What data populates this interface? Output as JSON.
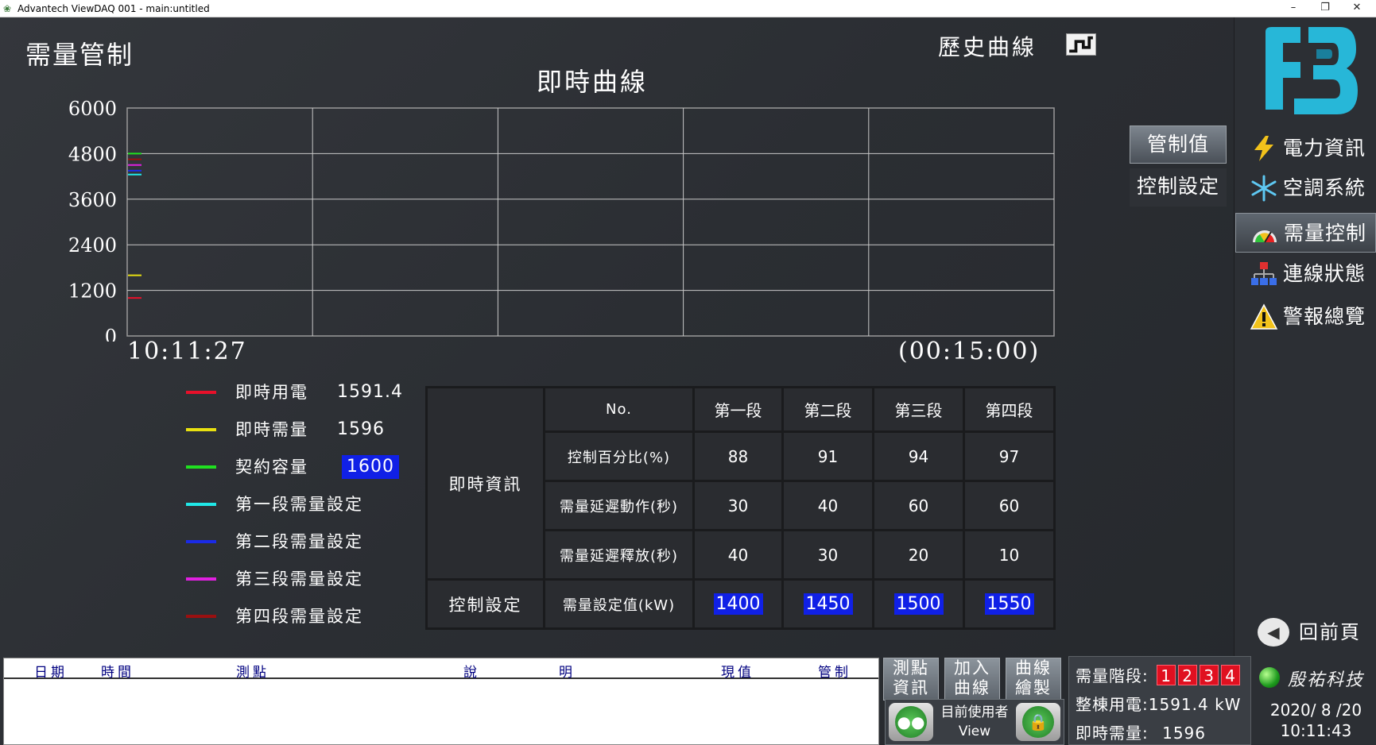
{
  "window": {
    "title": "Advantech ViewDAQ 001 - main:untitled",
    "minimize": "–",
    "restore": "❐",
    "close": "✕"
  },
  "header": {
    "page_title": "需量管制",
    "history_label": "歷史曲線"
  },
  "chart_data": {
    "type": "line",
    "title": "即時曲線",
    "ylim": [
      0,
      6000
    ],
    "y_ticks": [
      "6000",
      "4800",
      "3600",
      "2400",
      "1200",
      "0"
    ],
    "x_start_label": "10:11:27",
    "x_span_label": "(00:15:00)",
    "grid": true,
    "series": [
      {
        "name": "即時用電",
        "color": "#e8102a",
        "values": [
          1000
        ]
      },
      {
        "name": "即時需量",
        "color": "#e8e010",
        "values": [
          1596
        ]
      },
      {
        "name": "契約容量",
        "color": "#20e020",
        "values": [
          4800
        ]
      },
      {
        "name": "第一段需量設定",
        "color": "#20e8e8",
        "values": [
          4250
        ]
      },
      {
        "name": "第二段需量設定",
        "color": "#1a2ae8",
        "values": [
          4350
        ]
      },
      {
        "name": "第三段需量設定",
        "color": "#e020e0",
        "values": [
          4500
        ]
      },
      {
        "name": "第四段需量設定",
        "color": "#9a1010",
        "values": [
          4650
        ]
      }
    ]
  },
  "legend": [
    {
      "label": "即時用電",
      "color": "#e8102a",
      "value": "1591.4",
      "highlight": false
    },
    {
      "label": "即時需量",
      "color": "#e8e010",
      "value": "1596",
      "highlight": false
    },
    {
      "label": "契約容量",
      "color": "#20e020",
      "value": "1600",
      "highlight": true
    },
    {
      "label": "第一段需量設定",
      "color": "#20e8e8",
      "value": "",
      "highlight": false
    },
    {
      "label": "第二段需量設定",
      "color": "#1a2ae8",
      "value": "",
      "highlight": false
    },
    {
      "label": "第三段需量設定",
      "color": "#e020e0",
      "value": "",
      "highlight": false
    },
    {
      "label": "第四段需量設定",
      "color": "#9a1010",
      "value": "",
      "highlight": false
    }
  ],
  "table": {
    "no_label": "No.",
    "stages": [
      "第一段",
      "第二段",
      "第三段",
      "第四段"
    ],
    "group_realtime": "即時資訊",
    "group_control": "控制設定",
    "rows": [
      {
        "label": "控制百分比(%)",
        "values": [
          "88",
          "91",
          "94",
          "97"
        ]
      },
      {
        "label": "需量延遲動作(秒)",
        "values": [
          "30",
          "40",
          "60",
          "60"
        ]
      },
      {
        "label": "需量延遲釋放(秒)",
        "values": [
          "40",
          "30",
          "20",
          "10"
        ]
      }
    ],
    "setpoint_row": {
      "label": "需量設定值(kW)",
      "values": [
        "1400",
        "1450",
        "1500",
        "1550"
      ]
    }
  },
  "side_tabs": {
    "control_value": "管制值",
    "control_setting": "控制設定"
  },
  "right_nav": [
    {
      "label": "電力資訊",
      "icon": "lightning-icon"
    },
    {
      "label": "空調系統",
      "icon": "snowflake-icon"
    },
    {
      "label": "需量控制",
      "icon": "gauge-icon"
    },
    {
      "label": "連線狀態",
      "icon": "network-icon"
    },
    {
      "label": "警報總覽",
      "icon": "warning-icon"
    }
  ],
  "back_label": "回前頁",
  "log": {
    "headers": [
      "日期",
      "時間",
      "測點",
      "說",
      "明",
      "現值",
      "管制"
    ]
  },
  "bottom_buttons": [
    {
      "line1": "測點",
      "line2": "資訊"
    },
    {
      "line1": "加入",
      "line2": "曲線"
    },
    {
      "line1": "曲線",
      "line2": "繪製"
    }
  ],
  "user": {
    "label": "目前使用者",
    "name": "View"
  },
  "status": {
    "stage_label": "需量階段:",
    "stages": [
      "1",
      "2",
      "3",
      "4"
    ],
    "building_label": "整棟用電:",
    "building_value": "1591.4 kW",
    "demand_label": "即時需量:",
    "demand_value": "1596"
  },
  "clock": {
    "brand": "殷祐科技",
    "date": "2020/ 8 /20",
    "time": "10:11:43"
  }
}
